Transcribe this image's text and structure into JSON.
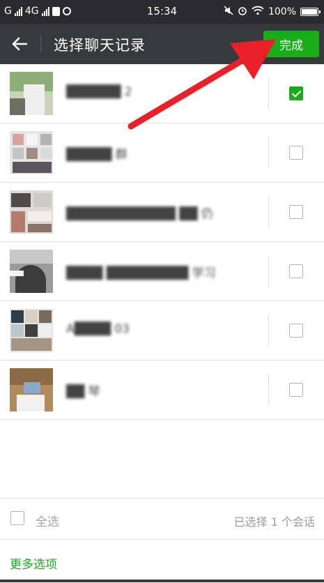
{
  "status_bar": {
    "carrier_left": "G",
    "network_type": "4G",
    "time": "15:34",
    "battery": "100%",
    "icons": [
      "signal-bars-icon",
      "signal-bars-icon",
      "sim-icon",
      "location-icon",
      "mute-icon",
      "alarm-icon",
      "wifi-icon",
      "battery-icon"
    ]
  },
  "header": {
    "title": "选择聊天记录",
    "done_label": "完成",
    "back_icon": "back-arrow-icon"
  },
  "chats": [
    {
      "name": "██████ 2",
      "checked": true
    },
    {
      "name": "█████ 群",
      "checked": false
    },
    {
      "name": "████████████ ██ 仍",
      "checked": false
    },
    {
      "name": "████ █████████ 学习",
      "checked": false
    },
    {
      "name": "A████ 03",
      "checked": false
    },
    {
      "name": "██ 琴",
      "checked": false
    }
  ],
  "footer": {
    "select_all_label": "全选",
    "selected_count_text": "已选择 1 个会话",
    "more_options_label": "更多选项"
  },
  "colors": {
    "accent": "#1aad19",
    "navbar": "#37393b",
    "statusbar": "#2b2b2d",
    "annotation_arrow": "#e8202a"
  }
}
